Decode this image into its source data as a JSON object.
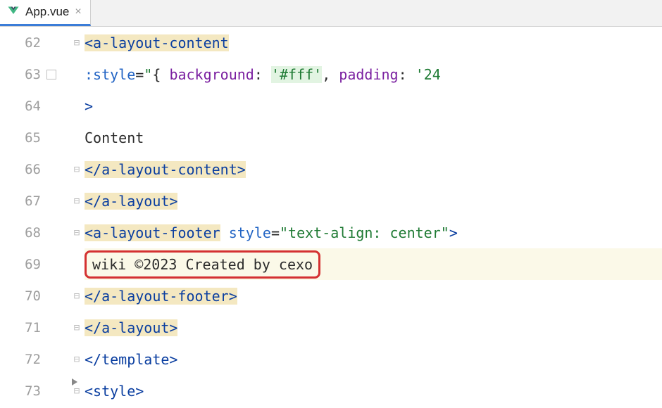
{
  "tab": {
    "filename": "App.vue",
    "close_glyph": "×"
  },
  "gutter": {
    "start": 62,
    "lines": [
      "62",
      "63",
      "64",
      "65",
      "66",
      "67",
      "68",
      "69",
      "70",
      "71",
      "72",
      "73"
    ]
  },
  "code": {
    "l62": {
      "open": "<",
      "tag": "a-layout-content"
    },
    "l63": {
      "attr": ":style",
      "eq": "=",
      "q": "\"",
      "brace1": "{ ",
      "k1": "background",
      "c1": ": ",
      "v1": "'#fff'",
      "sep": ", ",
      "k2": "padding",
      "c2": ": ",
      "v2": "'24"
    },
    "l64": {
      "text": ">"
    },
    "l65": {
      "text": "Content"
    },
    "l66": {
      "open": "</",
      "tag": "a-layout-content",
      "close": ">"
    },
    "l67": {
      "open": "</",
      "tag": "a-layout",
      "close": ">"
    },
    "l68": {
      "open": "<",
      "tag": "a-layout-footer",
      "sp": " ",
      "attr": "style",
      "eq": "=",
      "val": "\"text-align: center\"",
      "close": ">"
    },
    "l69": {
      "text": "wiki ©2023 Created by cexo"
    },
    "l70": {
      "open": "</",
      "tag": "a-layout-footer",
      "close": ">"
    },
    "l71": {
      "open": "</",
      "tag": "a-layout",
      "close": ">"
    },
    "l72": {
      "open": "</",
      "tag": "template",
      "close": ">"
    },
    "l73": {
      "open": "<",
      "tag": "style",
      "close": ">"
    }
  }
}
